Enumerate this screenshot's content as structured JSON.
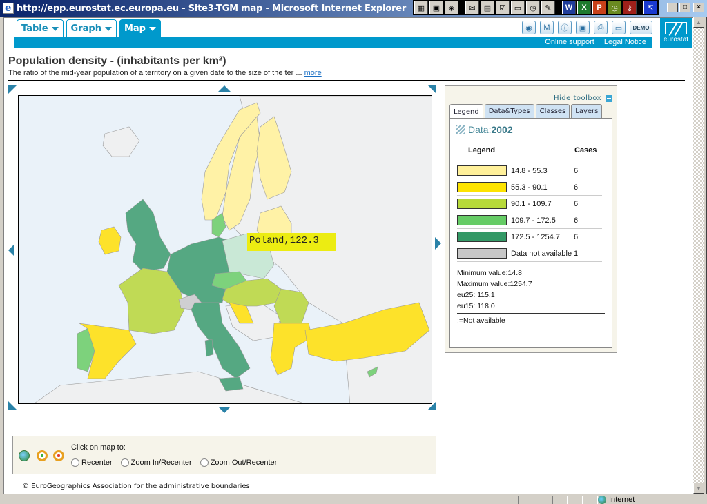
{
  "window": {
    "title": "http://epp.eurostat.ec.europa.eu - Site3-TGM map - Microsoft Internet Explorer",
    "controls": [
      "_",
      "□",
      "×"
    ]
  },
  "tabs": [
    {
      "label": "Table",
      "active": false
    },
    {
      "label": "Graph",
      "active": false
    },
    {
      "label": "Map",
      "active": true
    }
  ],
  "toolbar": {
    "icons": [
      "globe-icon",
      "word-doc-icon",
      "info-icon",
      "save-icon",
      "print-icon",
      "folder-icon"
    ],
    "demo_label": "DEMO",
    "links": [
      "Online support",
      "Legal Notice"
    ],
    "logo_text": "eurostat"
  },
  "page": {
    "title": "Population density - (inhabitants per km²)",
    "description": "The ratio of the mid-year population of a territory on a given date to the size of the ter ...",
    "more_link": "more"
  },
  "map": {
    "tooltip": "Poland,122.3",
    "colors": {
      "sea": "#eaf2f9",
      "nonEU": "#eff0f1",
      "class1": "#fff2a6",
      "class2": "#fde22a",
      "class3": "#c0da55",
      "class4": "#7dd27c",
      "class5": "#55a882",
      "na": "#cfcfd2",
      "highlight": "#c9e8d6"
    }
  },
  "toolbox": {
    "hide_label": "Hide toolbox",
    "tabs": [
      "Legend",
      "Data&Types",
      "Classes",
      "Layers"
    ],
    "active_tab": "Legend",
    "data_label": "Data:",
    "data_year": "2002",
    "legend_header": "Legend",
    "cases_header": "Cases",
    "classes": [
      {
        "range": "14.8 - 55.3",
        "cases": "6",
        "color": "#fff09a"
      },
      {
        "range": "55.3 - 90.1",
        "cases": "6",
        "color": "#fde300"
      },
      {
        "range": "90.1 - 109.7",
        "cases": "6",
        "color": "#b7d93a"
      },
      {
        "range": "109.7 - 172.5",
        "cases": "6",
        "color": "#66cc66"
      },
      {
        "range": "172.5 - 1254.7",
        "cases": "6",
        "color": "#339966"
      },
      {
        "range": "Data not available",
        "cases": "1",
        "color": "#c8c8c8"
      }
    ],
    "stats": {
      "min": "Minimum value:14.8",
      "max": "Maximum value:1254.7",
      "eu25": "eu25: 115.1",
      "eu15": "eu15: 118.0",
      "na_note": ":=Not available"
    }
  },
  "controls": {
    "prompt": "Click on map to:",
    "options": [
      "Recenter",
      "Zoom In/Recenter",
      "Zoom Out/Recenter"
    ]
  },
  "copyright": "© EuroGeographics Association for the administrative boundaries",
  "status": {
    "zone": "Internet"
  }
}
